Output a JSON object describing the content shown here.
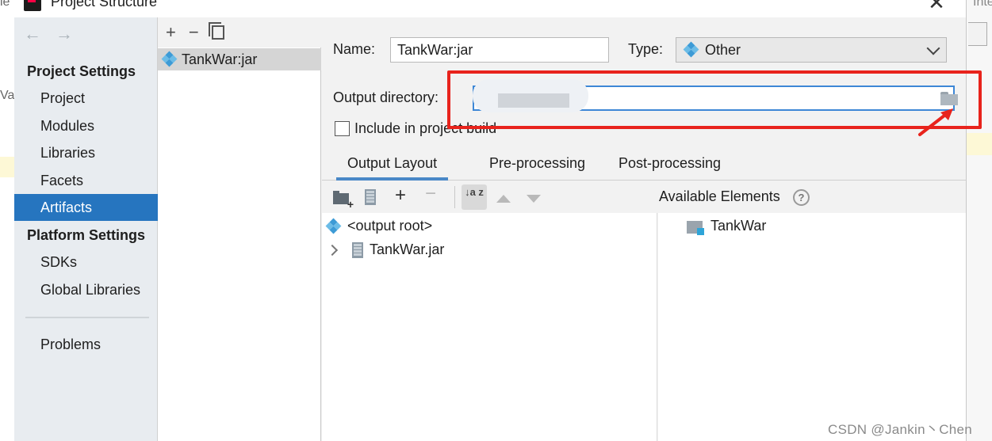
{
  "window": {
    "title": "Project Structure",
    "close_glyph": "✕"
  },
  "nav": {
    "back_glyph": "←",
    "forward_glyph": "→",
    "project_settings_heading": "Project Settings",
    "project_settings_items": [
      "Project",
      "Modules",
      "Libraries",
      "Facets",
      "Artifacts"
    ],
    "platform_settings_heading": "Platform Settings",
    "platform_settings_items": [
      "SDKs",
      "Global Libraries"
    ],
    "problems_label": "Problems",
    "active_item": "Artifacts"
  },
  "artifacts_list": {
    "add_glyph": "+",
    "remove_glyph": "−",
    "items": [
      "TankWar:jar"
    ]
  },
  "form": {
    "name_label": "Name:",
    "name_value": "TankWar:jar",
    "type_label": "Type:",
    "type_value": "Other",
    "output_dir_label": "Output directory:",
    "output_dir_value": "",
    "include_in_build_label": "Include in project build",
    "include_in_build_checked": false
  },
  "tabs": [
    {
      "label": "Output Layout",
      "active": true
    },
    {
      "label": "Pre-processing",
      "active": false
    },
    {
      "label": "Post-processing",
      "active": false
    }
  ],
  "layout_toolbar": {
    "plus_glyph": "+",
    "minus_glyph": "−",
    "sort_glyph": "↓a z"
  },
  "output_tree": {
    "root_label": "<output root>",
    "child_label": "TankWar.jar"
  },
  "available_elements": {
    "label": "Available Elements",
    "help_glyph": "?",
    "items": [
      "TankWar"
    ]
  },
  "colors": {
    "accent_selected": "#2675bf",
    "highlight_annotation": "#e8231c",
    "artifact_icon": "#3d9bd6"
  },
  "watermark": "CSDN @Jankin丶Chen",
  "background_fragments": {
    "left_top": "le",
    "left_mid": "Va",
    "right_top": "Inte"
  }
}
